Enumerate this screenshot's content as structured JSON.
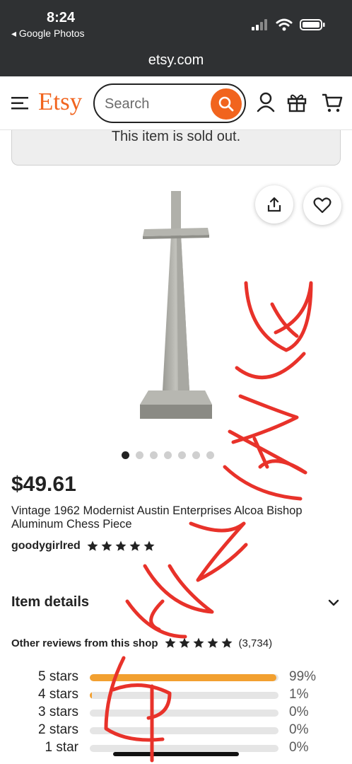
{
  "status_bar": {
    "time": "8:24",
    "back_app": "◂ Google Photos"
  },
  "browser": {
    "url": "etsy.com"
  },
  "header": {
    "logo": "Etsy",
    "search_placeholder": "Search"
  },
  "notice": {
    "sold_out": "This item is sold out."
  },
  "image_carousel": {
    "total_images": 7,
    "active_index": 0
  },
  "product": {
    "price": "$49.61",
    "title": "Vintage 1962 Modernist Austin Enterprises Alcoa Bishop Aluminum Chess Piece",
    "shop_name": "goodygirlred",
    "shop_rating_stars": 5
  },
  "sections": {
    "item_details": "Item details"
  },
  "reviews": {
    "label": "Other reviews from this shop",
    "stars": 5,
    "count": "(3,734)",
    "breakdown": [
      {
        "label": "5 stars",
        "percent_text": "99%",
        "fraction": 0.99
      },
      {
        "label": "4 stars",
        "percent_text": "1%",
        "fraction": 0.01
      },
      {
        "label": "3 stars",
        "percent_text": "0%",
        "fraction": 0
      },
      {
        "label": "2 stars",
        "percent_text": "0%",
        "fraction": 0
      },
      {
        "label": "1 star",
        "percent_text": "0%",
        "fraction": 0
      }
    ]
  },
  "colors": {
    "accent": "#f1641e",
    "rating_bar": "#f2a030",
    "annotation": "#e8322a"
  },
  "icons": [
    "back-arrow-icon",
    "signal-icon",
    "wifi-icon",
    "battery-icon",
    "menu-icon",
    "search-icon",
    "account-icon",
    "gift-icon",
    "cart-icon",
    "share-icon",
    "heart-icon",
    "star-icon",
    "chevron-down-icon"
  ]
}
